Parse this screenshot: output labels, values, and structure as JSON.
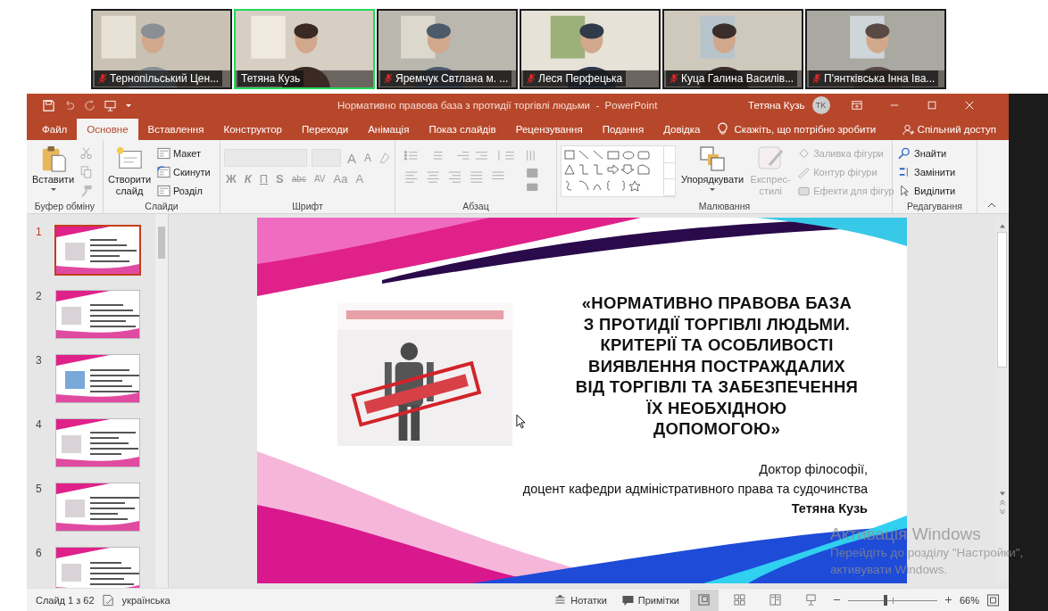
{
  "participants": [
    {
      "name": "Тернопільський Цен...",
      "muted": true,
      "selected": false
    },
    {
      "name": "Тетяна Кузь",
      "muted": false,
      "selected": true
    },
    {
      "name": "Яремчук Свтлана м. ...",
      "muted": true,
      "selected": false
    },
    {
      "name": "Леся Перфецька",
      "muted": true,
      "selected": false
    },
    {
      "name": "Куца Галина Василів...",
      "muted": true,
      "selected": false
    },
    {
      "name": "П'янтківська Інна Іва...",
      "muted": true,
      "selected": false
    }
  ],
  "app": {
    "title": "Нормативно правова база з протидії торгівлі людьми  -  PowerPoint",
    "user": "Тетяна Кузь",
    "initials": "TK"
  },
  "tabs": [
    {
      "label": "Файл",
      "selected": false
    },
    {
      "label": "Основне",
      "selected": true
    },
    {
      "label": "Вставлення",
      "selected": false
    },
    {
      "label": "Конструктор",
      "selected": false
    },
    {
      "label": "Переходи",
      "selected": false
    },
    {
      "label": "Анімація",
      "selected": false
    },
    {
      "label": "Показ слайдів",
      "selected": false
    },
    {
      "label": "Рецензування",
      "selected": false
    },
    {
      "label": "Подання",
      "selected": false
    },
    {
      "label": "Довідка",
      "selected": false
    }
  ],
  "tell_me": "Скажіть, що потрібно зробити",
  "share": "Спільний доступ",
  "ribbon": {
    "clipboard": {
      "label": "Буфер обміну",
      "paste": "Вставити"
    },
    "slides": {
      "label": "Слайди",
      "new_slide": "Створити слайд",
      "items": [
        "Макет",
        "Скинути",
        "Розділ"
      ]
    },
    "font": {
      "label": "Шрифт",
      "top": [
        "A",
        "A"
      ],
      "bottom": [
        "Ж",
        "К",
        "П",
        "S",
        "abc",
        "AV",
        "Aa",
        "A"
      ]
    },
    "paragraph": {
      "label": "Абзац"
    },
    "drawing": {
      "label": "Малювання",
      "arrange": "Упорядкувати",
      "quick_styles": {
        "label": "Експрес-стилі",
        "disabled": true
      },
      "format": [
        {
          "label": "Заливка фігури",
          "disabled": true
        },
        {
          "label": "Контур фігури",
          "disabled": true
        },
        {
          "label": "Ефекти для фігур",
          "disabled": true
        }
      ]
    },
    "editing": {
      "label": "Редагування",
      "items": [
        "Знайти",
        "Замінити",
        "Виділити"
      ]
    }
  },
  "slides": [
    {
      "number": "1",
      "selected": true
    },
    {
      "number": "2",
      "selected": false
    },
    {
      "number": "3",
      "selected": false
    },
    {
      "number": "4",
      "selected": false
    },
    {
      "number": "5",
      "selected": false
    },
    {
      "number": "6",
      "selected": false
    }
  ],
  "slide": {
    "title_lines": [
      "«НОРМАТИВНО ПРАВОВА БАЗА",
      "З ПРОТИДІЇ ТОРГІВЛІ ЛЮДЬМИ.",
      "КРИТЕРІЇ ТА ОСОБЛИВОСТІ",
      "ВИЯВЛЕННЯ ПОСТРАЖДАЛИХ",
      "ВІД ТОРГІВЛІ ТА ЗАБЕЗПЕЧЕННЯ",
      "ЇХ НЕОБХІДНОЮ",
      "ДОПОМОГОЮ»"
    ],
    "degree": "Доктор філософії,",
    "position": "доцент кафедри адміністративного права та судочинства",
    "author": "Тетяна Кузь"
  },
  "status": {
    "slide": "Слайд 1 з 62",
    "language": "українська",
    "notes": "Нотатки",
    "comments": "Примітки",
    "views": [
      {
        "selected": true
      },
      {
        "selected": false
      },
      {
        "selected": false
      },
      {
        "selected": false
      }
    ],
    "zoom": {
      "level": 0.42,
      "reading": "66%"
    }
  },
  "activation": {
    "title": "Активація Windows",
    "line1": "Перейдіть до розділу \"Настройки\",",
    "line2": "активувати Windows."
  }
}
